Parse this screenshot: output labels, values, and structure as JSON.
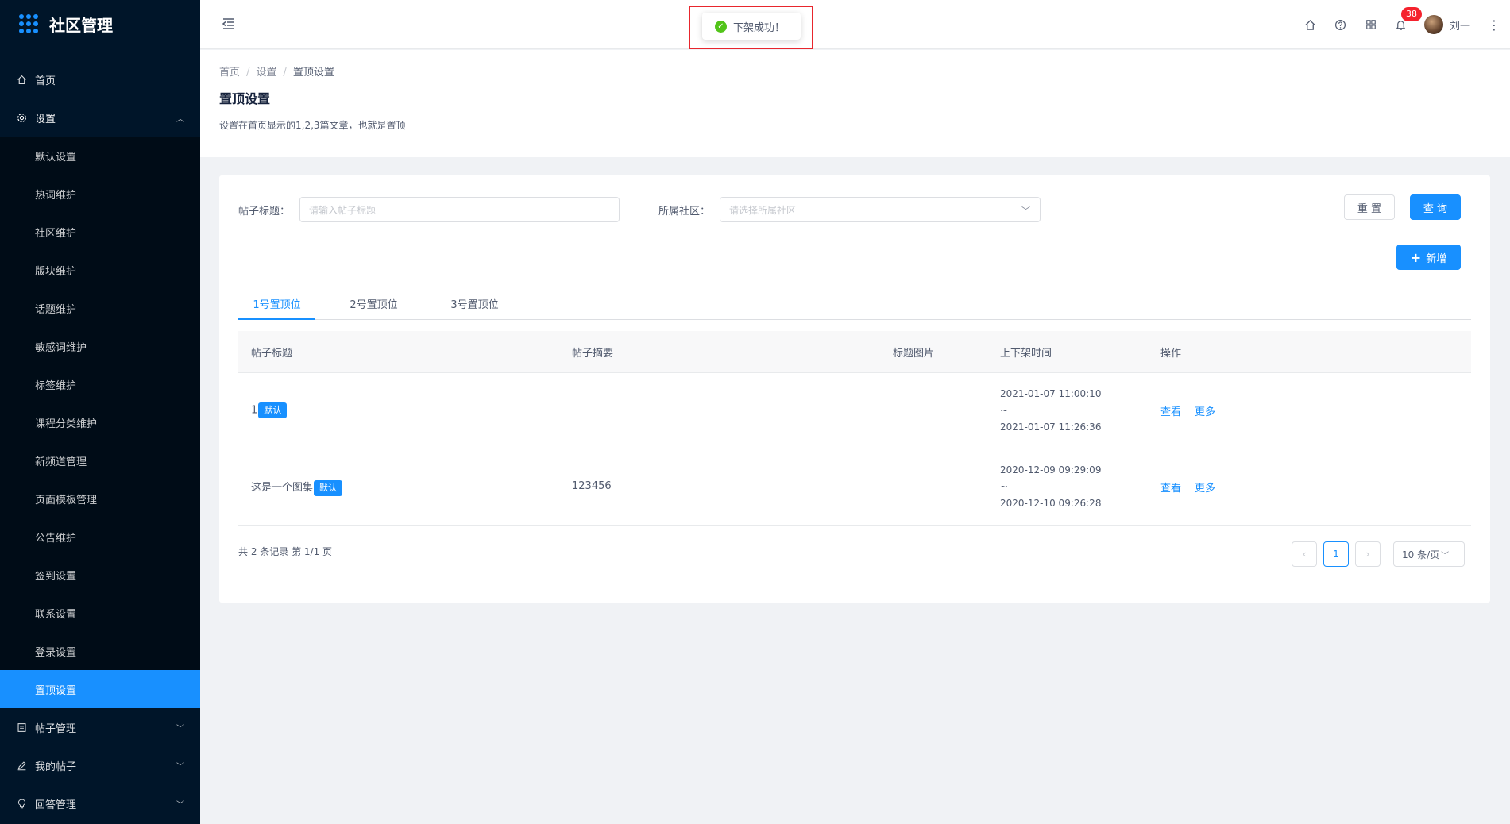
{
  "app": {
    "title": "社区管理"
  },
  "sidebar": {
    "home": "首页",
    "settings": {
      "label": "设置",
      "items": [
        "默认设置",
        "热词维护",
        "社区维护",
        "版块维护",
        "话题维护",
        "敏感词维护",
        "标签维护",
        "课程分类维护",
        "新频道管理",
        "页面模板管理",
        "公告维护",
        "签到设置",
        "联系设置",
        "登录设置",
        "置顶设置"
      ],
      "active": "置顶设置"
    },
    "posts": "帖子管理",
    "my_posts": "我的帖子",
    "answers": "回答管理"
  },
  "header": {
    "notification_count": "38",
    "username": "刘一"
  },
  "toast": {
    "message": "下架成功！"
  },
  "breadcrumb": [
    "首页",
    "设置",
    "置顶设置"
  ],
  "page": {
    "title": "置顶设置",
    "description": "设置在首页显示的1,2,3篇文章，也就是置顶"
  },
  "filters": {
    "title_label": "帖子标题：",
    "title_placeholder": "请输入帖子标题",
    "community_label": "所属社区：",
    "community_placeholder": "请选择所属社区",
    "reset": "重 置",
    "query": "查 询",
    "add": "新增"
  },
  "tabs": [
    "1号置顶位",
    "2号置顶位",
    "3号置顶位"
  ],
  "table": {
    "columns": [
      "帖子标题",
      "帖子摘要",
      "标题图片",
      "上下架时间",
      "操作"
    ],
    "rows": [
      {
        "title": "1",
        "tag": "默认",
        "summary": "",
        "start": "2021-01-07 11:00:10",
        "tilde": "~",
        "end": "2021-01-07 11:26:36",
        "view": "查看",
        "more": "更多"
      },
      {
        "title": "这是一个图集",
        "tag": "默认",
        "summary": "123456",
        "start": "2020-12-09 09:29:09",
        "tilde": "~",
        "end": "2020-12-10 09:26:28",
        "view": "查看",
        "more": "更多"
      }
    ]
  },
  "pagination": {
    "summary": "共 2 条记录 第 1/1 页",
    "current": "1",
    "page_size": "10 条/页"
  },
  "colors": {
    "primary": "#1890ff",
    "sidebar": "#001529",
    "success": "#52c41a",
    "badge": "#f5222d"
  }
}
